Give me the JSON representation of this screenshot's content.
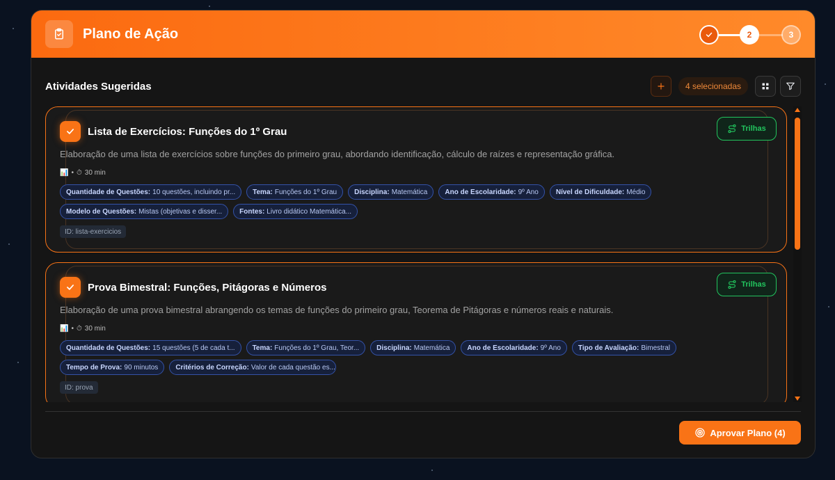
{
  "header": {
    "title": "Plano de Ação",
    "steps": [
      {
        "label": "",
        "state": "done"
      },
      {
        "label": "2",
        "state": "current"
      },
      {
        "label": "3",
        "state": "pending"
      }
    ]
  },
  "section": {
    "title": "Atividades Sugeridas",
    "selected_count_label": "4 selecionadas"
  },
  "cards": [
    {
      "title": "Lista de Exercícios: Funções do 1º Grau",
      "description": "Elaboração de uma lista de exercícios sobre funções do primeiro grau, abordando identificação, cálculo de raízes e representação gráfica.",
      "meta_separator": "•",
      "duration": "30 min",
      "trail_label": "Trilhas",
      "chips": [
        {
          "key": "Quantidade de Questões:",
          "value": "10 questões, incluindo pr..."
        },
        {
          "key": "Tema:",
          "value": "Funções do 1º Grau"
        },
        {
          "key": "Disciplina:",
          "value": "Matemática"
        },
        {
          "key": "Ano de Escolaridade:",
          "value": "9º Ano"
        },
        {
          "key": "Nível de Dificuldade:",
          "value": "Médio"
        },
        {
          "key": "Modelo de Questões:",
          "value": "Mistas (objetivas e disser..."
        },
        {
          "key": "Fontes:",
          "value": "Livro didático Matemática..."
        }
      ],
      "id_label": "ID: lista-exercicios"
    },
    {
      "title": "Prova Bimestral: Funções, Pitágoras e Números",
      "description": "Elaboração de uma prova bimestral abrangendo os temas de funções do primeiro grau, Teorema de Pitágoras e números reais e naturais.",
      "meta_separator": "•",
      "duration": "30 min",
      "trail_label": "Trilhas",
      "chips": [
        {
          "key": "Quantidade de Questões:",
          "value": "15 questões (5 de cada t..."
        },
        {
          "key": "Tema:",
          "value": "Funções do 1º Grau, Teor..."
        },
        {
          "key": "Disciplina:",
          "value": "Matemática"
        },
        {
          "key": "Ano de Escolaridade:",
          "value": "9º Ano"
        },
        {
          "key": "Tipo de Avaliação:",
          "value": "Bimestral"
        },
        {
          "key": "Tempo de Prova:",
          "value": "90 minutos"
        },
        {
          "key": "Critérios de Correção:",
          "value": "Valor de cada questão es..."
        }
      ],
      "id_label": "ID: prova"
    }
  ],
  "footer": {
    "approve_label": "Aprovar Plano (4)"
  },
  "colors": {
    "accent": "#f97316",
    "success": "#22c55e",
    "chip": "#3452a8"
  }
}
